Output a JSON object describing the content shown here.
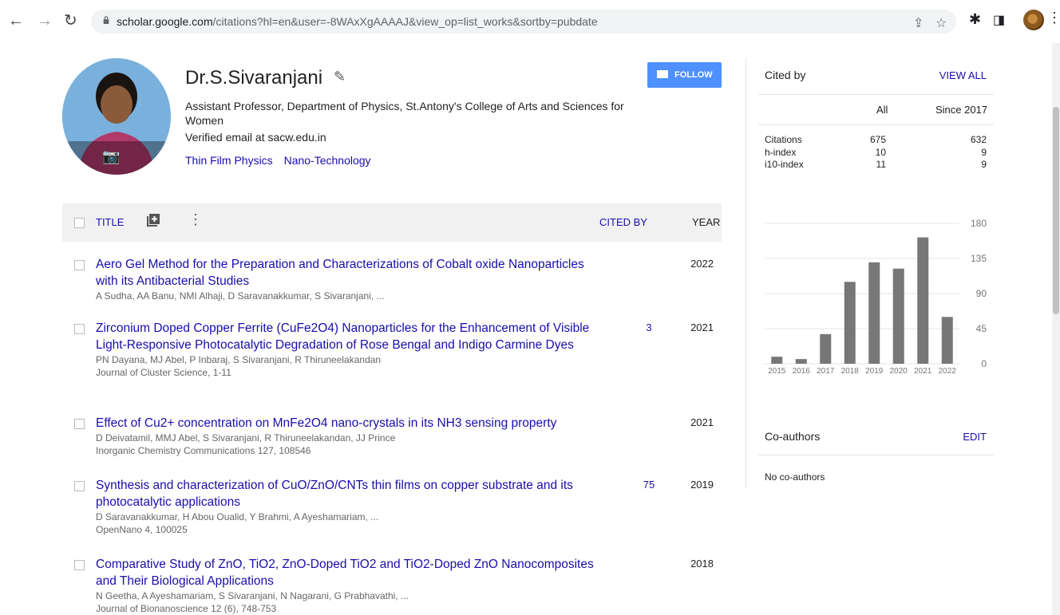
{
  "browser": {
    "url_host": "scholar.google.com",
    "url_rest": "/citations?hl=en&user=-8WAxXgAAAAJ&view_op=list_works&sortby=pubdate"
  },
  "profile": {
    "name": "Dr.S.Sivaranjani",
    "affiliation": "Assistant Professor, Department of Physics, St.Antony's College of Arts and Sciences for Women",
    "email": "Verified email at sacw.edu.in",
    "interests": [
      "Thin Film Physics",
      "Nano-Technology"
    ],
    "follow_label": "FOLLOW"
  },
  "table": {
    "title_label": "TITLE",
    "cited_by_label": "CITED BY",
    "year_label": "YEAR"
  },
  "papers": [
    {
      "title": "Aero Gel Method for the Preparation and Characterizations of Cobalt oxide Nanoparticles with its Antibacterial Studies",
      "authors": "A Sudha, AA Banu, NMI Alhaji, D Saravanakkumar, S Sivaranjani, ...",
      "venue": "",
      "cited_by": "",
      "year": "2022"
    },
    {
      "title": "Zirconium Doped Copper Ferrite (CuFe2O4) Nanoparticles for the Enhancement of Visible Light-Responsive Photocatalytic Degradation of Rose Bengal and Indigo Carmine Dyes",
      "authors": "PN Dayana, MJ Abel, P Inbaraj, S Sivaranjani, R Thiruneelakandan",
      "venue": "Journal of Cluster Science, 1-11",
      "cited_by": "3",
      "year": "2021"
    },
    {
      "title": "Effect of Cu2+ concentration on MnFe2O4 nano-crystals in its NH3 sensing property",
      "authors": "D Deivatamil, MMJ Abel, S Sivaranjani, R Thiruneelakandan, JJ Prince",
      "venue": "Inorganic Chemistry Communications 127, 108546",
      "cited_by": "",
      "year": "2021"
    },
    {
      "title": "Synthesis and characterization of CuO/ZnO/CNTs thin films on copper substrate and its photocatalytic applications",
      "authors": "D Saravanakkumar, H Abou Oualid, Y Brahmi, A Ayeshamariam, ...",
      "venue": "OpenNano 4, 100025",
      "cited_by": "75",
      "year": "2019"
    },
    {
      "title": "Comparative Study of ZnO, TiO2, ZnO-Doped TiO2 and TiO2-Doped ZnO Nanocomposites and Their Biological Applications",
      "authors": "N Geetha, A Ayeshamariam, S Sivaranjani, N Nagarani, G Prabhavathi, ...",
      "venue": "Journal of Bionanoscience 12 (6), 748-753",
      "cited_by": "",
      "year": "2018"
    }
  ],
  "cited_by": {
    "heading": "Cited by",
    "view_all": "VIEW ALL",
    "col_all": "All",
    "col_since": "Since 2017",
    "rows": [
      {
        "label": "Citations",
        "all": "675",
        "since": "632"
      },
      {
        "label": "h-index",
        "all": "10",
        "since": "9"
      },
      {
        "label": "i10-index",
        "all": "11",
        "since": "9"
      }
    ]
  },
  "chart_data": {
    "type": "bar",
    "categories": [
      "2015",
      "2016",
      "2017",
      "2018",
      "2019",
      "2020",
      "2021",
      "2022"
    ],
    "values": [
      9,
      6,
      38,
      105,
      130,
      122,
      162,
      60
    ],
    "ylim": [
      0,
      180
    ],
    "yticks": [
      "180",
      "135",
      "90",
      "45",
      "0"
    ],
    "grid": true,
    "bar_color": "#777777"
  },
  "coauthors": {
    "heading": "Co-authors",
    "edit": "EDIT",
    "empty": "No co-authors"
  }
}
